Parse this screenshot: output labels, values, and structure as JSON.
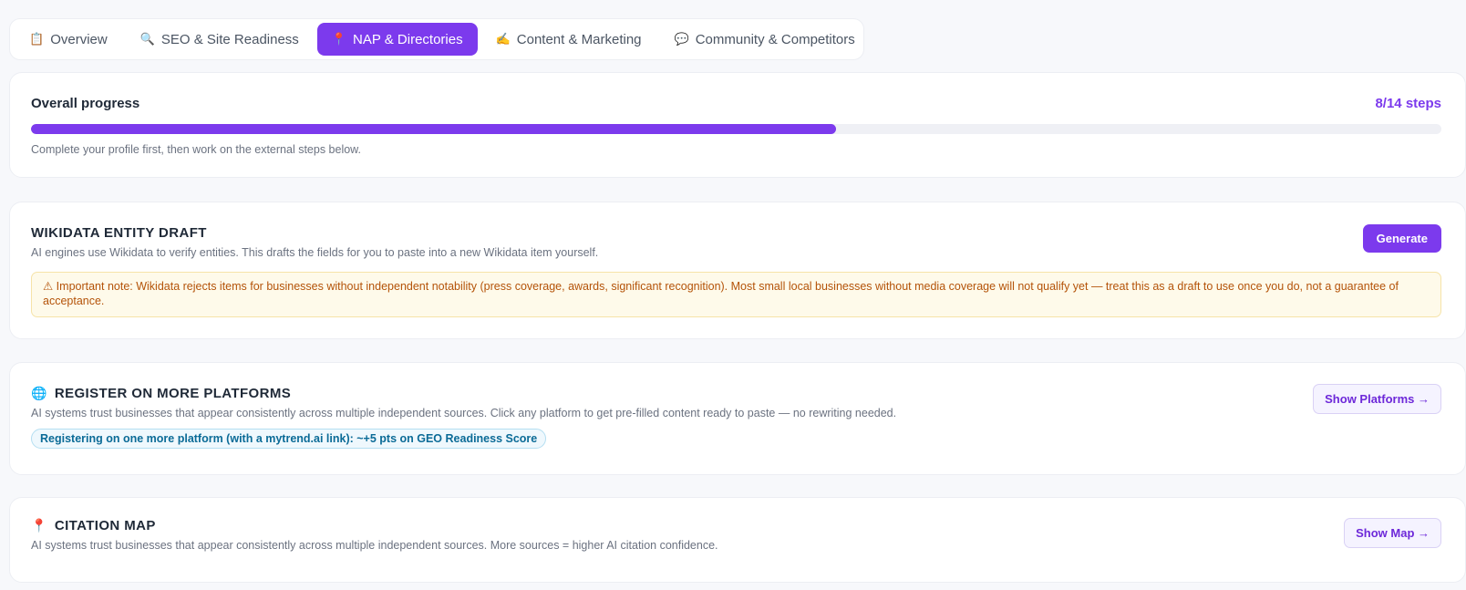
{
  "tabs": [
    {
      "label": "Overview",
      "icon": "📋",
      "icon_name": "clipboard-icon",
      "active": false
    },
    {
      "label": "SEO & Site Readiness",
      "icon": "🔍",
      "icon_name": "magnifier-icon",
      "active": false
    },
    {
      "label": "NAP & Directories",
      "icon": "📍",
      "icon_name": "pin-icon",
      "active": true
    },
    {
      "label": "Content & Marketing",
      "icon": "✍️",
      "icon_name": "writing-hand-icon",
      "active": false
    },
    {
      "label": "Community & Competitors",
      "icon": "💬",
      "icon_name": "speech-bubble-icon",
      "active": false
    }
  ],
  "progress": {
    "title": "Overall progress",
    "steps_label": "8/14 steps",
    "completed": 8,
    "total": 14,
    "fraction": 0.571,
    "hint": "Complete your profile first, then work on the external steps below."
  },
  "wikidata": {
    "title": "WIKIDATA ENTITY DRAFT",
    "description": "AI engines use Wikidata to verify entities. This drafts the fields for you to paste into a new Wikidata item yourself.",
    "button_label": "Generate",
    "warning": "⚠ Important note: Wikidata rejects items for businesses without independent notability (press coverage, awards, significant recognition). Most small local businesses without media coverage will not qualify yet — treat this as a draft to use once you do, not a guarantee of acceptance."
  },
  "platforms": {
    "icon": "🌐",
    "icon_name": "globe-icon",
    "title": "REGISTER ON MORE PLATFORMS",
    "description": "AI systems trust businesses that appear consistently across multiple independent sources. Click any platform to get pre-filled content ready to paste — no rewriting needed.",
    "pill": "Registering on one more platform (with a mytrend.ai link): ~+5 pts on GEO Readiness Score",
    "button_label": "Show Platforms →"
  },
  "citation": {
    "icon": "📍",
    "icon_name": "pin-icon",
    "title": "CITATION MAP",
    "description": "AI systems trust businesses that appear consistently across multiple independent sources. More sources = higher AI citation confidence.",
    "button_label": "Show Map →"
  },
  "colors": {
    "accent": "#7c3aed",
    "warning_text": "#b45309",
    "warning_bg": "#fefaea",
    "pill_text": "#0b6b97"
  }
}
